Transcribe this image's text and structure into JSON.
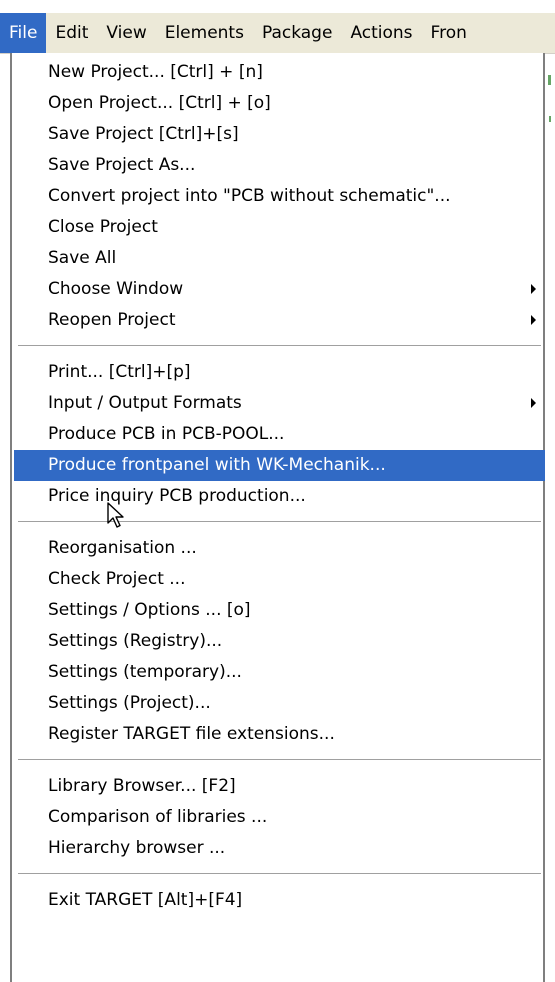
{
  "menubar": {
    "items": [
      "File",
      "Edit",
      "View",
      "Elements",
      "Package",
      "Actions",
      "Fron"
    ]
  },
  "menu": {
    "items": [
      {
        "label": "New Project...   [Ctrl] + [n]"
      },
      {
        "label": "Open Project...   [Ctrl] + [o]"
      },
      {
        "label": "Save Project   [Ctrl]+[s]"
      },
      {
        "label": "Save Project As..."
      },
      {
        "label": "Convert project into \"PCB without schematic\"..."
      },
      {
        "label": "Close Project"
      },
      {
        "label": "Save All"
      },
      {
        "label": "Choose Window",
        "submenu": true
      },
      {
        "label": "Reopen Project",
        "submenu": true
      },
      {
        "label": "Print...    [Ctrl]+[p]"
      },
      {
        "label": "Input / Output Formats",
        "submenu": true
      },
      {
        "label": "Produce PCB in PCB-POOL..."
      },
      {
        "label": "Produce frontpanel with WK-Mechanik...",
        "highlighted": true
      },
      {
        "label": "Price inquiry PCB production..."
      },
      {
        "label": "Reorganisation ..."
      },
      {
        "label": "Check Project ..."
      },
      {
        "label": "Settings / Options ...    [o]"
      },
      {
        "label": "Settings (Registry)..."
      },
      {
        "label": "Settings (temporary)..."
      },
      {
        "label": "Settings (Project)..."
      },
      {
        "label": "Register TARGET file extensions..."
      },
      {
        "label": "Library Browser...    [F2]"
      },
      {
        "label": "Comparison of libraries ..."
      },
      {
        "label": "Hierarchy browser ..."
      },
      {
        "label": "Exit TARGET    [Alt]+[F4]"
      }
    ]
  },
  "colors": {
    "highlight": "#316ac5",
    "menubar_bg": "#ece9d8",
    "menu_bg": "#ffffff"
  }
}
